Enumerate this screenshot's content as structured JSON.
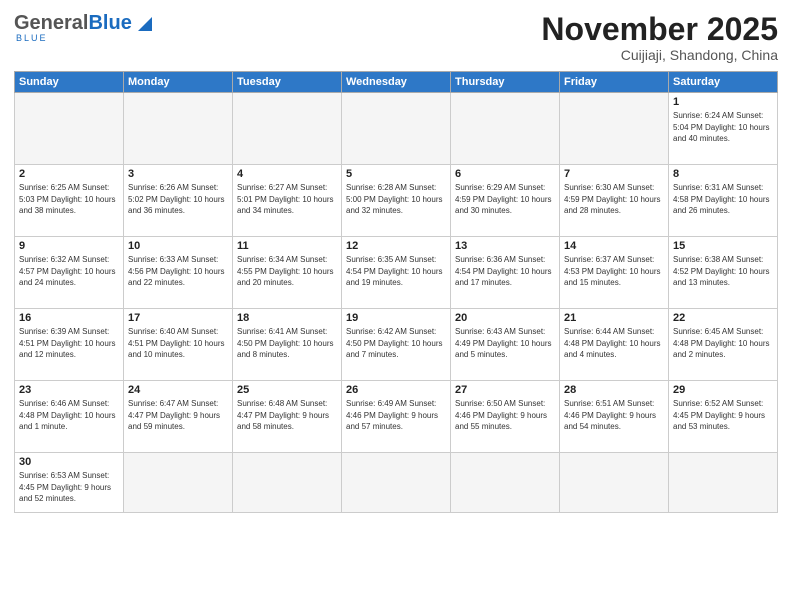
{
  "logo": {
    "general": "General",
    "blue": "Blue",
    "subtitle": "BLUE"
  },
  "title": "November 2025",
  "location": "Cuijiaji, Shandong, China",
  "weekdays": [
    "Sunday",
    "Monday",
    "Tuesday",
    "Wednesday",
    "Thursday",
    "Friday",
    "Saturday"
  ],
  "weeks": [
    [
      {
        "day": "",
        "info": ""
      },
      {
        "day": "",
        "info": ""
      },
      {
        "day": "",
        "info": ""
      },
      {
        "day": "",
        "info": ""
      },
      {
        "day": "",
        "info": ""
      },
      {
        "day": "",
        "info": ""
      },
      {
        "day": "1",
        "info": "Sunrise: 6:24 AM\nSunset: 5:04 PM\nDaylight: 10 hours\nand 40 minutes."
      }
    ],
    [
      {
        "day": "2",
        "info": "Sunrise: 6:25 AM\nSunset: 5:03 PM\nDaylight: 10 hours\nand 38 minutes."
      },
      {
        "day": "3",
        "info": "Sunrise: 6:26 AM\nSunset: 5:02 PM\nDaylight: 10 hours\nand 36 minutes."
      },
      {
        "day": "4",
        "info": "Sunrise: 6:27 AM\nSunset: 5:01 PM\nDaylight: 10 hours\nand 34 minutes."
      },
      {
        "day": "5",
        "info": "Sunrise: 6:28 AM\nSunset: 5:00 PM\nDaylight: 10 hours\nand 32 minutes."
      },
      {
        "day": "6",
        "info": "Sunrise: 6:29 AM\nSunset: 4:59 PM\nDaylight: 10 hours\nand 30 minutes."
      },
      {
        "day": "7",
        "info": "Sunrise: 6:30 AM\nSunset: 4:59 PM\nDaylight: 10 hours\nand 28 minutes."
      },
      {
        "day": "8",
        "info": "Sunrise: 6:31 AM\nSunset: 4:58 PM\nDaylight: 10 hours\nand 26 minutes."
      }
    ],
    [
      {
        "day": "9",
        "info": "Sunrise: 6:32 AM\nSunset: 4:57 PM\nDaylight: 10 hours\nand 24 minutes."
      },
      {
        "day": "10",
        "info": "Sunrise: 6:33 AM\nSunset: 4:56 PM\nDaylight: 10 hours\nand 22 minutes."
      },
      {
        "day": "11",
        "info": "Sunrise: 6:34 AM\nSunset: 4:55 PM\nDaylight: 10 hours\nand 20 minutes."
      },
      {
        "day": "12",
        "info": "Sunrise: 6:35 AM\nSunset: 4:54 PM\nDaylight: 10 hours\nand 19 minutes."
      },
      {
        "day": "13",
        "info": "Sunrise: 6:36 AM\nSunset: 4:54 PM\nDaylight: 10 hours\nand 17 minutes."
      },
      {
        "day": "14",
        "info": "Sunrise: 6:37 AM\nSunset: 4:53 PM\nDaylight: 10 hours\nand 15 minutes."
      },
      {
        "day": "15",
        "info": "Sunrise: 6:38 AM\nSunset: 4:52 PM\nDaylight: 10 hours\nand 13 minutes."
      }
    ],
    [
      {
        "day": "16",
        "info": "Sunrise: 6:39 AM\nSunset: 4:51 PM\nDaylight: 10 hours\nand 12 minutes."
      },
      {
        "day": "17",
        "info": "Sunrise: 6:40 AM\nSunset: 4:51 PM\nDaylight: 10 hours\nand 10 minutes."
      },
      {
        "day": "18",
        "info": "Sunrise: 6:41 AM\nSunset: 4:50 PM\nDaylight: 10 hours\nand 8 minutes."
      },
      {
        "day": "19",
        "info": "Sunrise: 6:42 AM\nSunset: 4:50 PM\nDaylight: 10 hours\nand 7 minutes."
      },
      {
        "day": "20",
        "info": "Sunrise: 6:43 AM\nSunset: 4:49 PM\nDaylight: 10 hours\nand 5 minutes."
      },
      {
        "day": "21",
        "info": "Sunrise: 6:44 AM\nSunset: 4:48 PM\nDaylight: 10 hours\nand 4 minutes."
      },
      {
        "day": "22",
        "info": "Sunrise: 6:45 AM\nSunset: 4:48 PM\nDaylight: 10 hours\nand 2 minutes."
      }
    ],
    [
      {
        "day": "23",
        "info": "Sunrise: 6:46 AM\nSunset: 4:48 PM\nDaylight: 10 hours\nand 1 minute."
      },
      {
        "day": "24",
        "info": "Sunrise: 6:47 AM\nSunset: 4:47 PM\nDaylight: 9 hours\nand 59 minutes."
      },
      {
        "day": "25",
        "info": "Sunrise: 6:48 AM\nSunset: 4:47 PM\nDaylight: 9 hours\nand 58 minutes."
      },
      {
        "day": "26",
        "info": "Sunrise: 6:49 AM\nSunset: 4:46 PM\nDaylight: 9 hours\nand 57 minutes."
      },
      {
        "day": "27",
        "info": "Sunrise: 6:50 AM\nSunset: 4:46 PM\nDaylight: 9 hours\nand 55 minutes."
      },
      {
        "day": "28",
        "info": "Sunrise: 6:51 AM\nSunset: 4:46 PM\nDaylight: 9 hours\nand 54 minutes."
      },
      {
        "day": "29",
        "info": "Sunrise: 6:52 AM\nSunset: 4:45 PM\nDaylight: 9 hours\nand 53 minutes."
      }
    ],
    [
      {
        "day": "30",
        "info": "Sunrise: 6:53 AM\nSunset: 4:45 PM\nDaylight: 9 hours\nand 52 minutes."
      },
      {
        "day": "",
        "info": ""
      },
      {
        "day": "",
        "info": ""
      },
      {
        "day": "",
        "info": ""
      },
      {
        "day": "",
        "info": ""
      },
      {
        "day": "",
        "info": ""
      },
      {
        "day": "",
        "info": ""
      }
    ]
  ]
}
